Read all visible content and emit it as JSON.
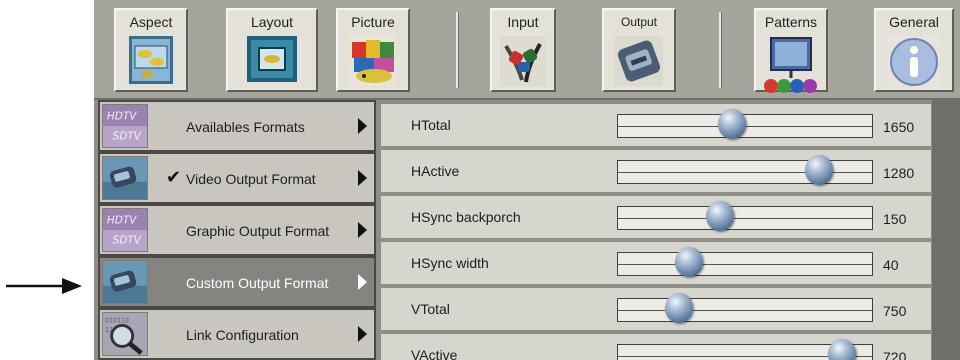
{
  "toolbar": {
    "buttons": [
      {
        "label": "Aspect",
        "icon": "aspect-icon"
      },
      {
        "label": "Layout",
        "icon": "layout-icon"
      },
      {
        "label": "Picture",
        "icon": "picture-icon"
      },
      {
        "label": "Input",
        "icon": "input-icon"
      },
      {
        "label": "Output",
        "icon": "output-icon"
      },
      {
        "label": "Patterns",
        "icon": "patterns-icon"
      },
      {
        "label": "General",
        "icon": "general-info-icon"
      }
    ]
  },
  "menu": {
    "items": [
      {
        "label": "Availables Formats",
        "icon": "hdtv-sdtv-icon",
        "checked": false,
        "selected": false
      },
      {
        "label": "Video Output Format",
        "icon": "video-connector-icon",
        "checked": true,
        "selected": false
      },
      {
        "label": "Graphic Output Format",
        "icon": "hdtv-sdtv-icon",
        "checked": false,
        "selected": false
      },
      {
        "label": "Custom Output Format",
        "icon": "video-connector-icon",
        "checked": false,
        "selected": true
      },
      {
        "label": "Link Configuration",
        "icon": "magnifier-icon",
        "checked": false,
        "selected": false
      }
    ],
    "check_mark": "✔"
  },
  "parameters": [
    {
      "label": "HTotal",
      "value": "1650",
      "level": 0.45
    },
    {
      "label": "HActive",
      "value": "1280",
      "level": 0.79
    },
    {
      "label": "HSync backporch",
      "value": "150",
      "level": 0.4
    },
    {
      "label": "HSync width",
      "value": "40",
      "level": 0.28
    },
    {
      "label": "VTotal",
      "value": "750",
      "level": 0.24
    },
    {
      "label": "VActive",
      "value": "720",
      "level": 0.88
    }
  ],
  "colors": {
    "window_bg": "#8e8d86",
    "toolbar_bg": "#a5a49d",
    "button_face": "#e4e2d8",
    "menu_item_bg": "#c8c6bf",
    "menu_selected_bg": "#858480",
    "row_bg": "#d6d5ce",
    "knob": "#5b7a9e"
  },
  "annotation": {
    "icon": "pointer-arrow-icon"
  }
}
